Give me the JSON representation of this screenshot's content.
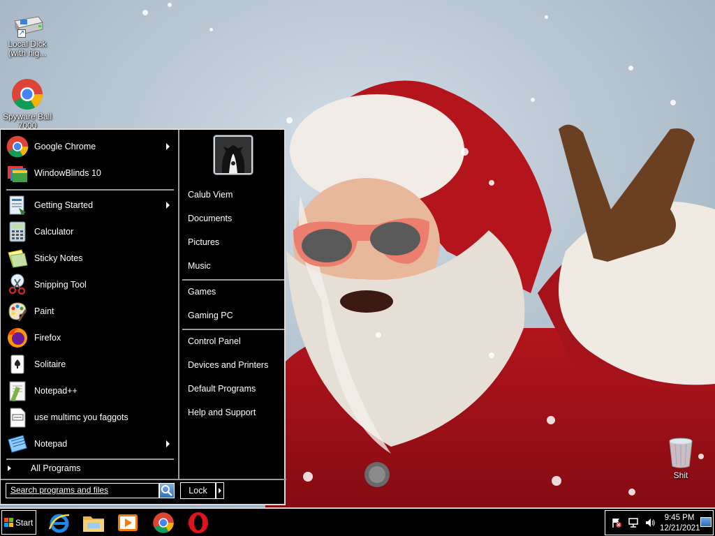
{
  "desktop": {
    "icons": [
      {
        "label_line1": "Local Dick",
        "label_line2": "(with hig...",
        "icon": "drive-icon"
      },
      {
        "label_line1": "Spyware Ball",
        "label_line2": "7000",
        "icon": "chrome-icon"
      }
    ],
    "recycle_bin": {
      "label": "Shit",
      "icon": "recycle-bin-icon"
    }
  },
  "start_menu": {
    "pinned": [
      {
        "label": "Google Chrome",
        "icon": "chrome-icon",
        "has_submenu": true
      },
      {
        "label": "WindowBlinds 10",
        "icon": "windowblinds-icon",
        "has_submenu": false
      }
    ],
    "recent": [
      {
        "label": "Getting Started",
        "icon": "getting-started-icon",
        "has_submenu": true
      },
      {
        "label": "Calculator",
        "icon": "calculator-icon",
        "has_submenu": false
      },
      {
        "label": "Sticky Notes",
        "icon": "sticky-notes-icon",
        "has_submenu": false
      },
      {
        "label": "Snipping Tool",
        "icon": "snipping-tool-icon",
        "has_submenu": false
      },
      {
        "label": "Paint",
        "icon": "paint-icon",
        "has_submenu": false
      },
      {
        "label": "Firefox",
        "icon": "firefox-icon",
        "has_submenu": false
      },
      {
        "label": "Solitaire",
        "icon": "solitaire-icon",
        "has_submenu": false
      },
      {
        "label": "Notepad++",
        "icon": "notepadpp-icon",
        "has_submenu": false
      },
      {
        "label": "use multimc you faggots",
        "icon": "file-icon",
        "has_submenu": false
      },
      {
        "label": "Notepad",
        "icon": "notepad-icon",
        "has_submenu": true
      }
    ],
    "all_programs": "All Programs",
    "search_placeholder": "Search programs and files",
    "lock_label": "Lock",
    "places_group1": [
      "Calub Viem",
      "Documents",
      "Pictures",
      "Music"
    ],
    "places_group2": [
      "Games",
      "Gaming PC"
    ],
    "places_group3": [
      "Control Panel",
      "Devices and Printers",
      "Default Programs",
      "Help and Support"
    ]
  },
  "taskbar": {
    "start_label": "Start",
    "pinned": [
      "internet-explorer-icon",
      "file-explorer-icon",
      "media-player-icon",
      "chrome-icon",
      "opera-icon"
    ],
    "tray_icons": [
      "action-center-flag-icon",
      "network-icon",
      "volume-icon"
    ],
    "time": "9:45 PM",
    "date": "12/21/2021"
  }
}
